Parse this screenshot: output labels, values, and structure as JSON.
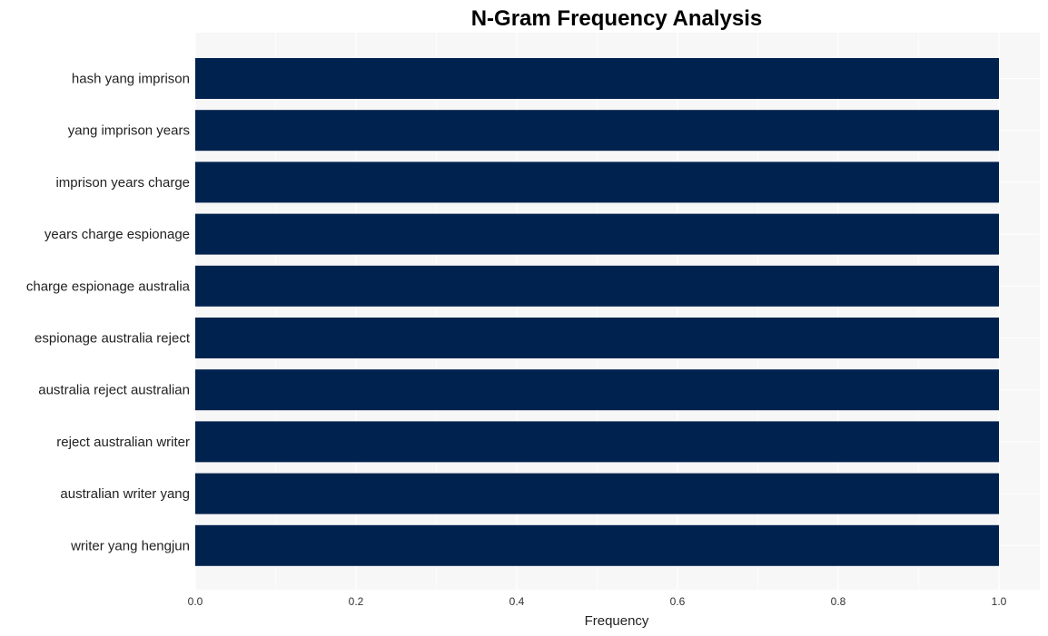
{
  "chart_data": {
    "type": "bar",
    "orientation": "horizontal",
    "title": "N-Gram Frequency Analysis",
    "xlabel": "Frequency",
    "ylabel": "",
    "xlim": [
      0,
      1.05
    ],
    "x_ticks": [
      "0.0",
      "0.2",
      "0.4",
      "0.6",
      "0.8",
      "1.0"
    ],
    "x_tick_values": [
      0,
      0.2,
      0.4,
      0.6,
      0.8,
      1.0
    ],
    "grid": true,
    "categories": [
      "hash yang imprison",
      "yang imprison years",
      "imprison years charge",
      "years charge espionage",
      "charge espionage australia",
      "espionage australia reject",
      "australia reject australian",
      "reject australian writer",
      "australian writer yang",
      "writer yang hengjun"
    ],
    "values": [
      1,
      1,
      1,
      1,
      1,
      1,
      1,
      1,
      1,
      1
    ],
    "bar_color": "#00224e",
    "background_color": "#f7f7f7"
  }
}
